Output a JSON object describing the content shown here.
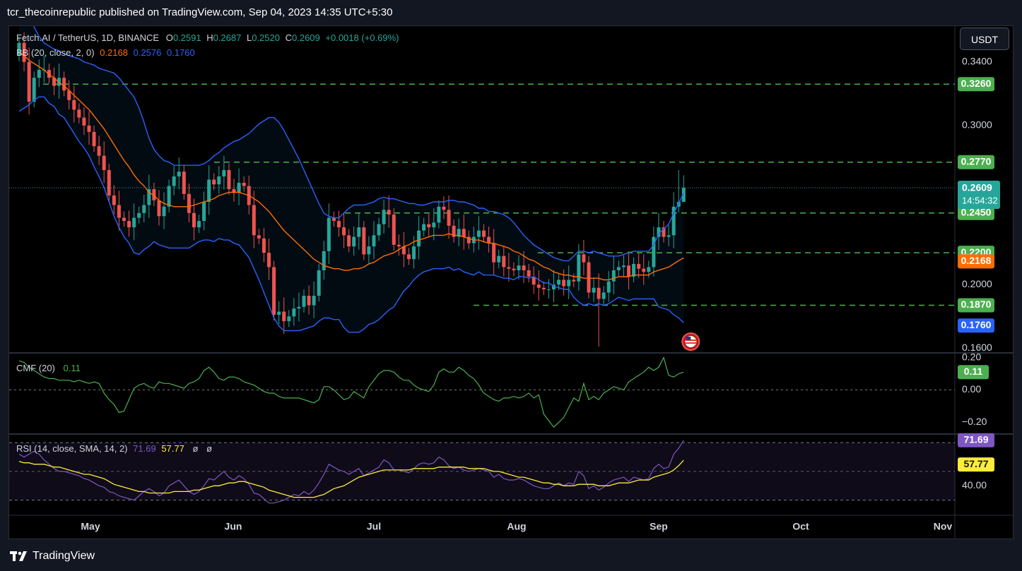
{
  "header": {
    "published_by": "tcr_thecoinrepublic published on TradingView.com, Sep 04, 2023 14:35 UTC+5:30"
  },
  "currency_button": "USDT",
  "footer": {
    "brand": "TradingView",
    "logo_icon": "tradingview-logo-icon"
  },
  "symbol_legend": {
    "name": "Fetch.AI / TetherUS, 1D, BINANCE",
    "o_label": "O",
    "o": "0.2591",
    "h_label": "H",
    "h": "0.2687",
    "l_label": "L",
    "l": "0.2520",
    "c_label": "C",
    "c": "0.2609",
    "change": "+0.0018 (+0.69%)"
  },
  "bb_legend": {
    "name": "BB (20, close, 2, 0)",
    "basis": "0.2168",
    "upper": "0.2576",
    "lower": "0.1760"
  },
  "cmf_legend": {
    "name": "CMF (20)",
    "value": "0.11"
  },
  "rsi_legend": {
    "name": "RSI (14, close, SMA, 14, 2)",
    "rsi": "71.69",
    "sma": "57.77",
    "extra1": "ø",
    "extra2": "ø"
  },
  "colors": {
    "bull": "#26a69a",
    "bear": "#ef5350",
    "bb_band": "#2962ff",
    "bb_basis": "#ff6d00",
    "level": "#4caf50",
    "cmf": "#4caf50",
    "rsi": "#7e57c2",
    "rsi_sma": "#ffeb3b",
    "background": "#000000",
    "axis_text": "#d1d4dc"
  },
  "chart_data": [
    {
      "type": "candlestick",
      "title": "Fetch.AI / TetherUS, 1D, BINANCE",
      "x_ticks": [
        "May",
        "Jun",
        "Jul",
        "Aug",
        "Sep",
        "Oct",
        "Nov"
      ],
      "y_ticks": [
        "0.1600",
        "0.2000",
        "0.3000",
        "0.3400"
      ],
      "ylim": [
        0.1575,
        0.3625
      ],
      "date_range": [
        "2023-04-21",
        "2023-09-04"
      ],
      "last": {
        "close": "0.2609",
        "countdown": "14:54:32"
      },
      "horizontal_levels": [
        {
          "value": 0.326,
          "label": "0.3260"
        },
        {
          "value": 0.277,
          "label": "0.2770"
        },
        {
          "value": 0.245,
          "label": "0.2450"
        },
        {
          "value": 0.22,
          "label": "0.2200"
        },
        {
          "value": 0.187,
          "label": "0.1870"
        }
      ],
      "close": [
        0.352,
        0.34,
        0.315,
        0.33,
        0.335,
        0.335,
        0.33,
        0.325,
        0.33,
        0.322,
        0.316,
        0.31,
        0.305,
        0.3,
        0.296,
        0.287,
        0.281,
        0.272,
        0.256,
        0.25,
        0.242,
        0.24,
        0.236,
        0.242,
        0.245,
        0.25,
        0.26,
        0.253,
        0.243,
        0.249,
        0.262,
        0.268,
        0.271,
        0.257,
        0.245,
        0.236,
        0.24,
        0.252,
        0.266,
        0.263,
        0.268,
        0.272,
        0.26,
        0.258,
        0.264,
        0.262,
        0.25,
        0.231,
        0.229,
        0.22,
        0.211,
        0.181,
        0.183,
        0.177,
        0.18,
        0.185,
        0.186,
        0.193,
        0.187,
        0.193,
        0.209,
        0.221,
        0.242,
        0.24,
        0.236,
        0.231,
        0.224,
        0.23,
        0.236,
        0.219,
        0.224,
        0.231,
        0.238,
        0.247,
        0.244,
        0.225,
        0.224,
        0.219,
        0.216,
        0.224,
        0.234,
        0.238,
        0.236,
        0.239,
        0.249,
        0.247,
        0.237,
        0.23,
        0.235,
        0.23,
        0.226,
        0.23,
        0.234,
        0.23,
        0.226,
        0.214,
        0.218,
        0.211,
        0.21,
        0.209,
        0.212,
        0.209,
        0.205,
        0.2,
        0.198,
        0.197,
        0.197,
        0.2,
        0.203,
        0.199,
        0.203,
        0.202,
        0.219,
        0.214,
        0.195,
        0.198,
        0.191,
        0.195,
        0.202,
        0.209,
        0.211,
        0.212,
        0.205,
        0.213,
        0.21,
        0.208,
        0.211,
        0.23,
        0.236,
        0.23,
        0.231,
        0.249,
        0.252,
        0.2609
      ],
      "series": [
        {
          "name": "BB basis",
          "values": [
            0.346,
            0.344,
            0.341,
            0.339,
            0.337,
            0.335,
            0.332,
            0.33,
            0.327,
            0.325,
            0.322,
            0.319,
            0.316,
            0.313,
            0.31,
            0.306,
            0.302,
            0.298,
            0.293,
            0.288,
            0.283,
            0.278,
            0.274,
            0.269,
            0.265,
            0.262,
            0.258,
            0.256,
            0.253,
            0.251,
            0.25,
            0.249,
            0.249,
            0.249,
            0.249,
            0.25,
            0.251,
            0.252,
            0.253,
            0.254,
            0.256,
            0.257,
            0.258,
            0.258,
            0.258,
            0.257,
            0.256,
            0.254,
            0.252,
            0.249,
            0.246,
            0.242,
            0.238,
            0.234,
            0.231,
            0.228,
            0.225,
            0.222,
            0.219,
            0.216,
            0.214,
            0.212,
            0.211,
            0.21,
            0.21,
            0.209,
            0.209,
            0.21,
            0.21,
            0.211,
            0.213,
            0.214,
            0.216,
            0.218,
            0.219,
            0.22,
            0.222,
            0.224,
            0.225,
            0.227,
            0.228,
            0.229,
            0.23,
            0.231,
            0.231,
            0.231,
            0.232,
            0.231,
            0.231,
            0.23,
            0.229,
            0.228,
            0.228,
            0.227,
            0.226,
            0.226,
            0.225,
            0.224,
            0.223,
            0.221,
            0.22,
            0.218,
            0.216,
            0.215,
            0.213,
            0.211,
            0.21,
            0.208,
            0.207,
            0.206,
            0.206,
            0.205,
            0.205,
            0.204,
            0.204,
            0.204,
            0.204,
            0.203,
            0.203,
            0.204,
            0.205,
            0.205,
            0.205,
            0.206,
            0.206,
            0.206,
            0.206,
            0.208,
            0.209,
            0.21,
            0.211,
            0.213,
            0.215,
            0.2168
          ]
        },
        {
          "name": "BB upper",
          "values": [
            0.383,
            0.377,
            0.369,
            0.362,
            0.356,
            0.352,
            0.35,
            0.348,
            0.347,
            0.345,
            0.344,
            0.343,
            0.342,
            0.34,
            0.339,
            0.338,
            0.336,
            0.335,
            0.334,
            0.333,
            0.33,
            0.326,
            0.322,
            0.318,
            0.311,
            0.302,
            0.292,
            0.285,
            0.281,
            0.278,
            0.277,
            0.275,
            0.275,
            0.275,
            0.275,
            0.275,
            0.275,
            0.276,
            0.278,
            0.281,
            0.283,
            0.286,
            0.288,
            0.29,
            0.291,
            0.293,
            0.295,
            0.298,
            0.301,
            0.303,
            0.305,
            0.305,
            0.302,
            0.297,
            0.291,
            0.285,
            0.279,
            0.272,
            0.265,
            0.258,
            0.251,
            0.245,
            0.243,
            0.242,
            0.242,
            0.245,
            0.248,
            0.25,
            0.25,
            0.25,
            0.251,
            0.252,
            0.254,
            0.255,
            0.254,
            0.254,
            0.253,
            0.252,
            0.251,
            0.251,
            0.25,
            0.25,
            0.251,
            0.252,
            0.252,
            0.252,
            0.253,
            0.253,
            0.252,
            0.252,
            0.251,
            0.25,
            0.248,
            0.248,
            0.246,
            0.246,
            0.245,
            0.244,
            0.242,
            0.239,
            0.235,
            0.231,
            0.228,
            0.225,
            0.223,
            0.221,
            0.219,
            0.217,
            0.216,
            0.215,
            0.215,
            0.218,
            0.221,
            0.221,
            0.22,
            0.221,
            0.22,
            0.219,
            0.218,
            0.218,
            0.218,
            0.219,
            0.22,
            0.221,
            0.221,
            0.221,
            0.221,
            0.225,
            0.232,
            0.235,
            0.238,
            0.245,
            0.251,
            0.2576
          ]
        },
        {
          "name": "BB lower",
          "values": [
            0.309,
            0.311,
            0.313,
            0.316,
            0.318,
            0.318,
            0.314,
            0.312,
            0.307,
            0.305,
            0.3,
            0.295,
            0.29,
            0.286,
            0.281,
            0.274,
            0.268,
            0.261,
            0.252,
            0.243,
            0.236,
            0.23,
            0.226,
            0.22,
            0.219,
            0.222,
            0.224,
            0.227,
            0.225,
            0.224,
            0.223,
            0.223,
            0.223,
            0.223,
            0.223,
            0.225,
            0.227,
            0.228,
            0.228,
            0.227,
            0.229,
            0.228,
            0.228,
            0.226,
            0.225,
            0.221,
            0.217,
            0.21,
            0.203,
            0.195,
            0.187,
            0.179,
            0.174,
            0.171,
            0.171,
            0.171,
            0.171,
            0.172,
            0.173,
            0.174,
            0.177,
            0.179,
            0.179,
            0.178,
            0.178,
            0.173,
            0.17,
            0.17,
            0.17,
            0.172,
            0.175,
            0.176,
            0.178,
            0.181,
            0.184,
            0.186,
            0.191,
            0.196,
            0.199,
            0.203,
            0.206,
            0.208,
            0.209,
            0.21,
            0.21,
            0.21,
            0.211,
            0.209,
            0.21,
            0.208,
            0.207,
            0.206,
            0.208,
            0.206,
            0.206,
            0.206,
            0.205,
            0.204,
            0.204,
            0.203,
            0.205,
            0.205,
            0.204,
            0.205,
            0.203,
            0.201,
            0.201,
            0.199,
            0.198,
            0.197,
            0.197,
            0.192,
            0.189,
            0.187,
            0.188,
            0.187,
            0.188,
            0.187,
            0.188,
            0.19,
            0.192,
            0.191,
            0.19,
            0.191,
            0.191,
            0.191,
            0.191,
            0.191,
            0.186,
            0.185,
            0.184,
            0.181,
            0.179,
            0.176
          ]
        }
      ]
    },
    {
      "type": "line",
      "title": "CMF (20)",
      "y_ticks": [
        "0.20",
        "0.00",
        "−0.20"
      ],
      "ylim": [
        -0.26,
        0.22
      ],
      "series": [
        {
          "name": "CMF",
          "values": [
            0.18,
            0.17,
            0.14,
            0.12,
            0.1,
            0.08,
            0.07,
            0.07,
            0.06,
            0.06,
            0.06,
            0.05,
            0.06,
            0.05,
            0.04,
            0.05,
            0.04,
            -0.02,
            -0.06,
            -0.09,
            -0.14,
            -0.13,
            -0.06,
            0.01,
            0.03,
            0.04,
            0.02,
            0.01,
            0.05,
            0.04,
            0.04,
            0.03,
            0.02,
            0.01,
            0.04,
            0.05,
            0.07,
            0.12,
            0.14,
            0.11,
            0.07,
            0.06,
            0.08,
            0.08,
            0.07,
            0.05,
            0.04,
            0.03,
            0.01,
            -0.01,
            -0.02,
            -0.02,
            -0.04,
            -0.05,
            -0.05,
            -0.05,
            -0.05,
            -0.06,
            -0.07,
            -0.08,
            -0.06,
            0.02,
            0.02,
            0.0,
            -0.03,
            -0.06,
            -0.05,
            -0.01,
            -0.03,
            -0.05,
            0.02,
            0.06,
            0.1,
            0.12,
            0.12,
            0.11,
            0.08,
            0.06,
            0.06,
            0.03,
            0.01,
            0.0,
            -0.01,
            0.03,
            0.11,
            0.13,
            0.11,
            0.11,
            0.14,
            0.12,
            0.09,
            0.07,
            0.03,
            -0.02,
            -0.04,
            -0.06,
            -0.07,
            -0.05,
            -0.05,
            -0.04,
            -0.05,
            -0.04,
            -0.02,
            -0.05,
            -0.03,
            -0.15,
            -0.19,
            -0.23,
            -0.2,
            -0.17,
            -0.11,
            -0.05,
            -0.07,
            0.04,
            -0.06,
            -0.04,
            -0.06,
            -0.02,
            0.0,
            0.02,
            0.01,
            0.0,
            0.05,
            0.07,
            0.09,
            0.11,
            0.14,
            0.12,
            0.14,
            0.2,
            0.09,
            0.08,
            0.1,
            0.11
          ]
        }
      ]
    },
    {
      "type": "line",
      "title": "RSI (14, close, SMA, 14, 2)",
      "y_ticks": [
        "40.00"
      ],
      "ylim": [
        20,
        75
      ],
      "band": [
        30,
        70
      ],
      "series": [
        {
          "name": "RSI",
          "values": [
            62,
            60,
            62,
            64,
            62,
            58,
            55,
            52,
            50,
            50,
            49,
            48,
            47,
            45,
            44,
            42,
            40,
            39,
            36,
            35,
            33,
            32,
            31,
            30,
            33,
            36,
            38,
            36,
            33,
            35,
            40,
            42,
            44,
            40,
            36,
            34,
            36,
            40,
            45,
            44,
            47,
            50,
            46,
            44,
            47,
            45,
            41,
            35,
            34,
            31,
            28,
            28,
            29,
            30,
            32,
            34,
            33,
            36,
            34,
            37,
            42,
            48,
            55,
            53,
            51,
            50,
            48,
            50,
            52,
            47,
            49,
            51,
            53,
            58,
            56,
            51,
            51,
            50,
            49,
            52,
            55,
            56,
            55,
            56,
            60,
            58,
            54,
            52,
            53,
            51,
            50,
            51,
            52,
            51,
            50,
            46,
            48,
            45,
            44,
            44,
            45,
            44,
            42,
            40,
            39,
            38,
            38,
            40,
            42,
            40,
            42,
            41,
            50,
            47,
            38,
            40,
            37,
            39,
            42,
            44,
            45,
            46,
            43,
            46,
            45,
            44,
            45,
            52,
            55,
            52,
            53,
            62,
            66,
            71.69
          ]
        },
        {
          "name": "RSI-based MA",
          "values": [
            57,
            56,
            56,
            55,
            55,
            55,
            54,
            53,
            53,
            52,
            51,
            50,
            49,
            48,
            48,
            47,
            46,
            45,
            43,
            41,
            40,
            39,
            38,
            37,
            36,
            36,
            35,
            35,
            35,
            35,
            35,
            36,
            36,
            36,
            36,
            37,
            37,
            38,
            39,
            40,
            40,
            41,
            42,
            42,
            43,
            43,
            42,
            41,
            40,
            39,
            37,
            36,
            35,
            34,
            33,
            32,
            32,
            32,
            32,
            32,
            33,
            34,
            36,
            38,
            39,
            40,
            42,
            44,
            46,
            47,
            48,
            49,
            50,
            51,
            51,
            51,
            51,
            51,
            51,
            52,
            52,
            52,
            52,
            52,
            53,
            53,
            53,
            53,
            53,
            53,
            52,
            52,
            52,
            52,
            51,
            50,
            50,
            49,
            48,
            47,
            46,
            46,
            45,
            44,
            43,
            42,
            42,
            41,
            41,
            40,
            40,
            40,
            41,
            41,
            41,
            41,
            40,
            40,
            40,
            41,
            42,
            42,
            42,
            43,
            44,
            44,
            44,
            46,
            47,
            48,
            49,
            51,
            54,
            57.77
          ]
        }
      ]
    }
  ]
}
